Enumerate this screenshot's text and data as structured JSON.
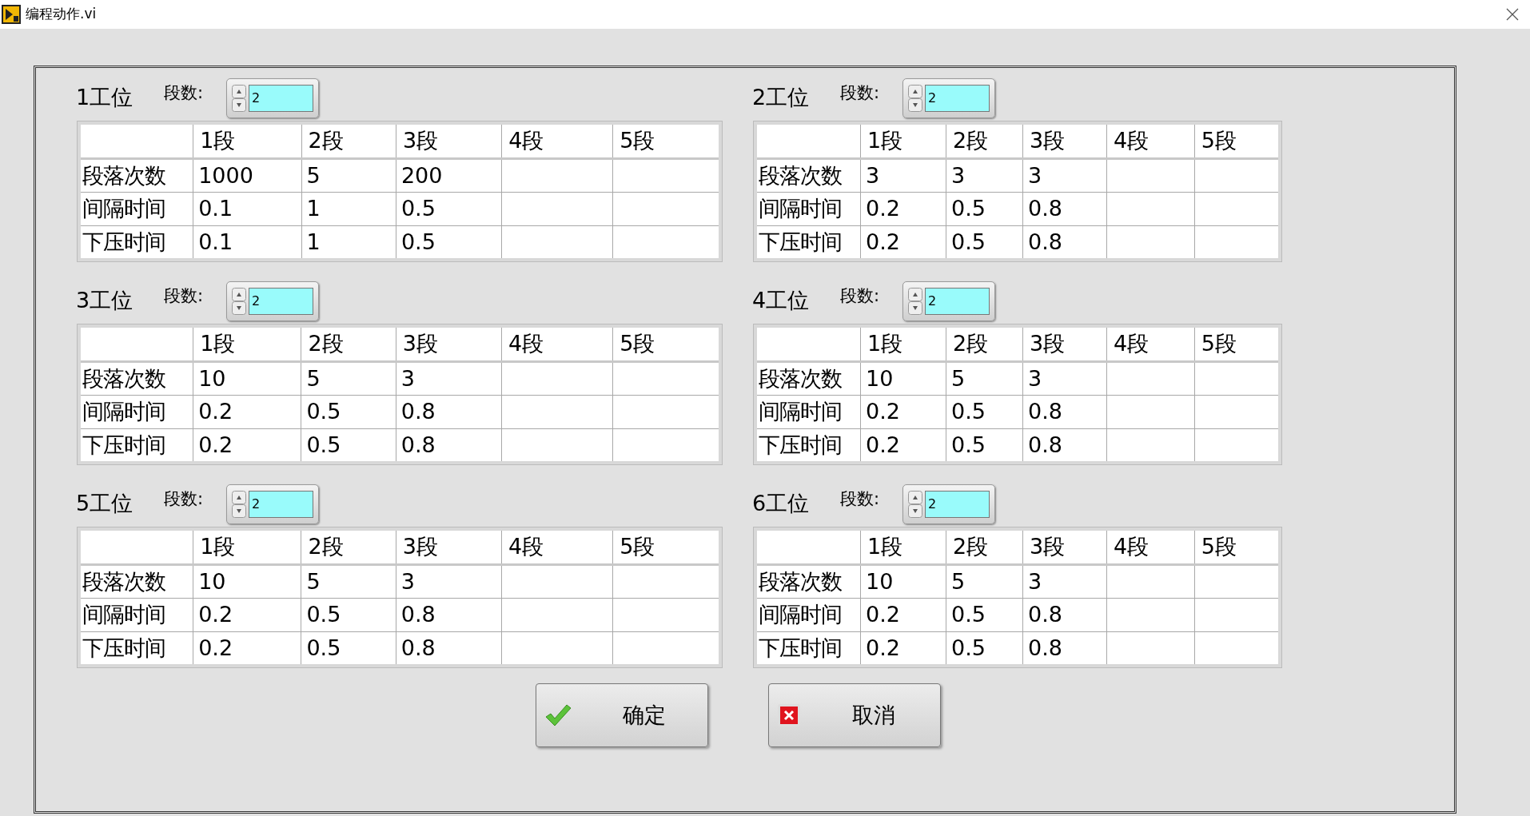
{
  "window": {
    "title": "编程动作.vi"
  },
  "stations": [
    {
      "label": "1工位",
      "count_label": "段数:",
      "count_value": "2",
      "columns": [
        "1段",
        "2段",
        "3段",
        "4段",
        "5段"
      ],
      "rows": [
        {
          "label": "段落次数",
          "cells": [
            "1000",
            "5",
            "200"
          ]
        },
        {
          "label": "间隔时间",
          "cells": [
            "0.1",
            "1",
            "0.5"
          ]
        },
        {
          "label": "下压时间",
          "cells": [
            "0.1",
            "1",
            "0.5"
          ]
        }
      ]
    },
    {
      "label": "2工位",
      "count_label": "段数:",
      "count_value": "2",
      "columns": [
        "1段",
        "2段",
        "3段",
        "4段",
        "5段"
      ],
      "rows": [
        {
          "label": "段落次数",
          "cells": [
            "3",
            "3",
            "3"
          ]
        },
        {
          "label": "间隔时间",
          "cells": [
            "0.2",
            "0.5",
            "0.8"
          ]
        },
        {
          "label": "下压时间",
          "cells": [
            "0.2",
            "0.5",
            "0.8"
          ]
        }
      ]
    },
    {
      "label": "3工位",
      "count_label": "段数:",
      "count_value": "2",
      "columns": [
        "1段",
        "2段",
        "3段",
        "4段",
        "5段"
      ],
      "rows": [
        {
          "label": "段落次数",
          "cells": [
            "10",
            "5",
            "3"
          ]
        },
        {
          "label": "间隔时间",
          "cells": [
            "0.2",
            "0.5",
            "0.8"
          ]
        },
        {
          "label": "下压时间",
          "cells": [
            "0.2",
            "0.5",
            "0.8"
          ]
        }
      ]
    },
    {
      "label": "4工位",
      "count_label": "段数:",
      "count_value": "2",
      "columns": [
        "1段",
        "2段",
        "3段",
        "4段",
        "5段"
      ],
      "rows": [
        {
          "label": "段落次数",
          "cells": [
            "10",
            "5",
            "3"
          ]
        },
        {
          "label": "间隔时间",
          "cells": [
            "0.2",
            "0.5",
            "0.8"
          ]
        },
        {
          "label": "下压时间",
          "cells": [
            "0.2",
            "0.5",
            "0.8"
          ]
        }
      ]
    },
    {
      "label": "5工位",
      "count_label": "段数:",
      "count_value": "2",
      "columns": [
        "1段",
        "2段",
        "3段",
        "4段",
        "5段"
      ],
      "rows": [
        {
          "label": "段落次数",
          "cells": [
            "10",
            "5",
            "3"
          ]
        },
        {
          "label": "间隔时间",
          "cells": [
            "0.2",
            "0.5",
            "0.8"
          ]
        },
        {
          "label": "下压时间",
          "cells": [
            "0.2",
            "0.5",
            "0.8"
          ]
        }
      ]
    },
    {
      "label": "6工位",
      "count_label": "段数:",
      "count_value": "2",
      "columns": [
        "1段",
        "2段",
        "3段",
        "4段",
        "5段"
      ],
      "rows": [
        {
          "label": "段落次数",
          "cells": [
            "10",
            "5",
            "3"
          ]
        },
        {
          "label": "间隔时间",
          "cells": [
            "0.2",
            "0.5",
            "0.8"
          ]
        },
        {
          "label": "下压时间",
          "cells": [
            "0.2",
            "0.5",
            "0.8"
          ]
        }
      ]
    }
  ],
  "buttons": [
    {
      "label": "确定",
      "kind": "ok"
    },
    {
      "label": "取消",
      "kind": "cancel"
    }
  ]
}
